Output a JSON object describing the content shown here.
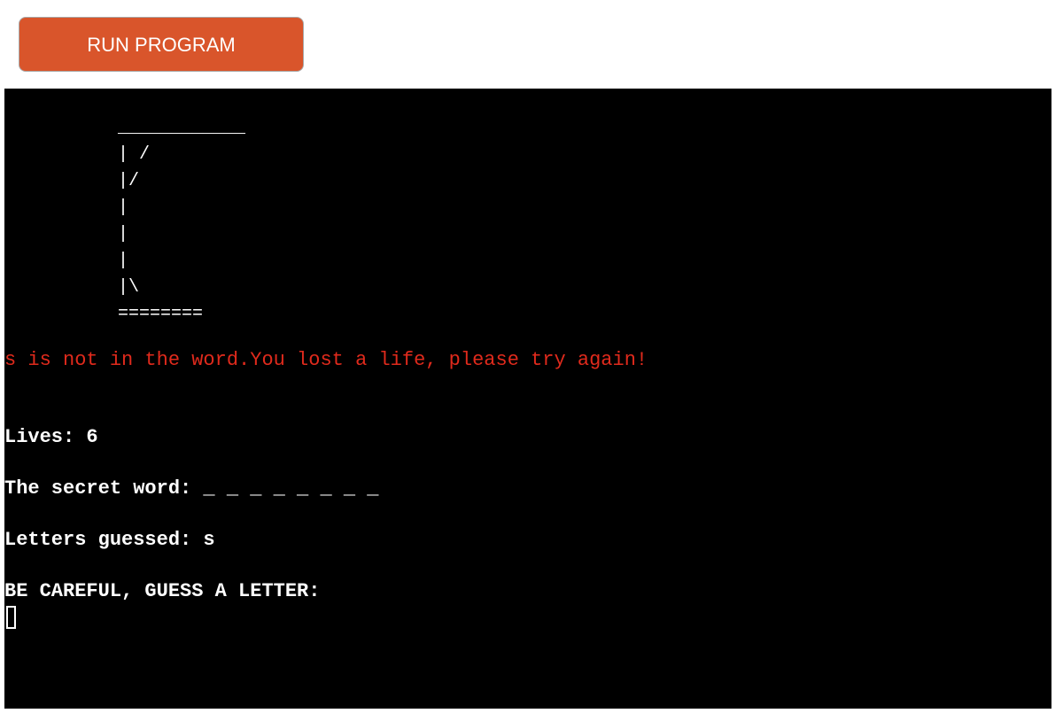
{
  "run_button": {
    "label": "RUN PROGRAM"
  },
  "terminal": {
    "gallows_art": " ____________\n | /\n |/\n |\n |\n |\n |\\\n ========",
    "error_message": "s is not in the word.You lost a life, please try again!",
    "lives_line": "Lives: 6",
    "secret_word_line": "The secret word: _ _ _ _ _ _ _ _",
    "letters_guessed_line": "Letters guessed: s",
    "prompt_line": "BE CAREFUL, GUESS A LETTER:",
    "colors": {
      "background": "#000000",
      "text": "#ffffff",
      "error": "#e02a1c"
    }
  },
  "colors": {
    "button": "#d9552b"
  }
}
